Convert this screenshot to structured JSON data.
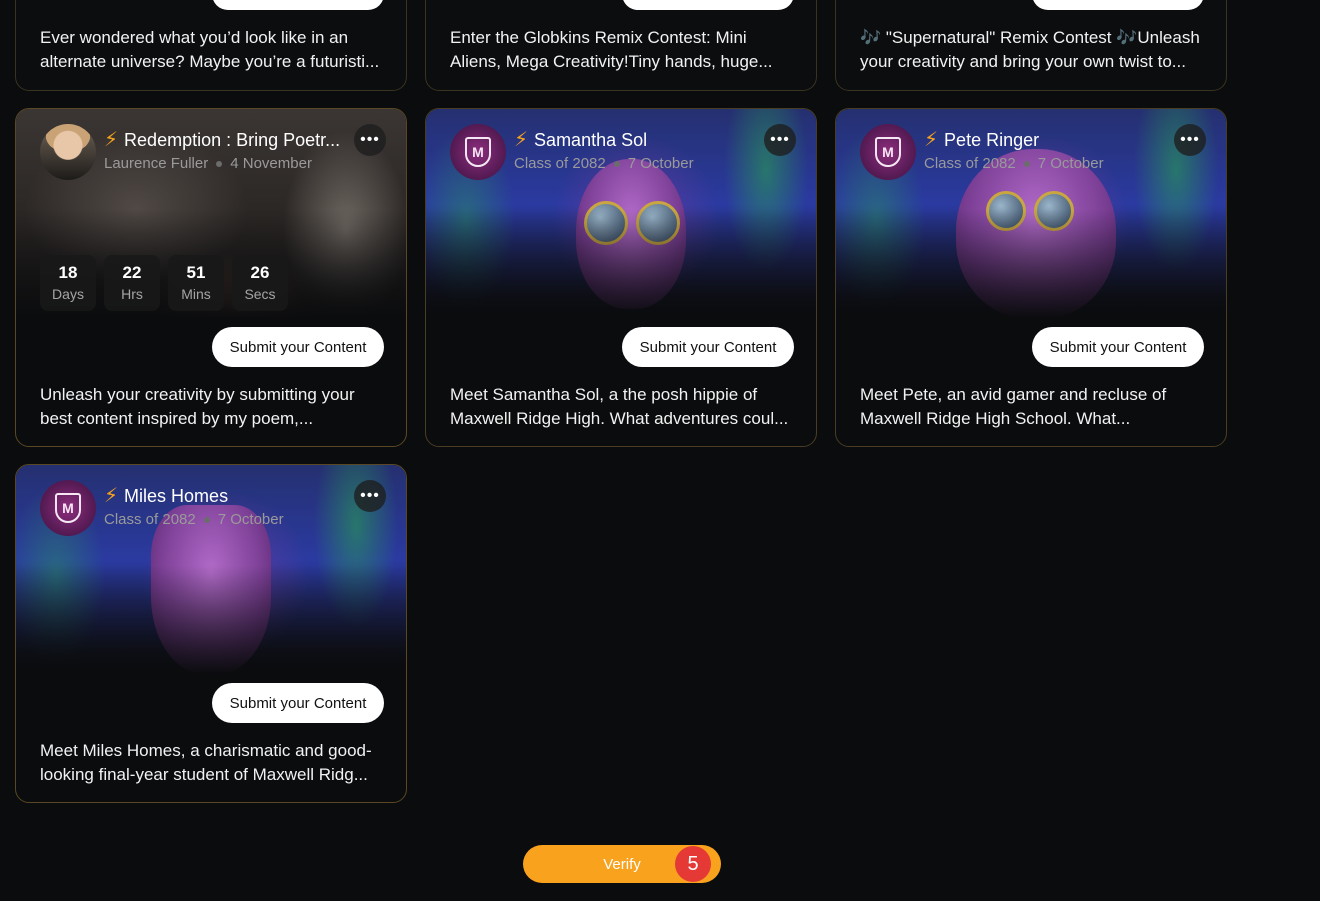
{
  "top_cards": [
    {
      "description": "Ever wondered what you’d look like in an alternate universe? Maybe you’re a futuristi..."
    },
    {
      "description": "Enter the Globkins Remix Contest: Mini Aliens, Mega Creativity!Tiny hands, huge..."
    },
    {
      "description": "🎶 \"Supernatural\" Remix Contest 🎶Unleash your creativity and bring your own twist to..."
    }
  ],
  "cards": [
    {
      "title": "Redemption : Bring Poetr...",
      "author": "Laurence Fuller",
      "date": "4 November",
      "countdown": [
        {
          "value": "18",
          "label": "Days"
        },
        {
          "value": "22",
          "label": "Hrs"
        },
        {
          "value": "51",
          "label": "Mins"
        },
        {
          "value": "26",
          "label": "Secs"
        }
      ],
      "button": "Submit your Content",
      "description": "Unleash your creativity by submitting your best content inspired by my poem,..."
    },
    {
      "title": "Samantha Sol",
      "author": "Class of 2082",
      "date": "7 October",
      "button": "Submit your Content",
      "description": "Meet Samantha Sol, a the posh hippie of Maxwell Ridge High. What adventures coul..."
    },
    {
      "title": "Pete Ringer",
      "author": "Class of 2082",
      "date": "7 October",
      "button": "Submit your Content",
      "description": "Meet Pete, an avid gamer and recluse of Maxwell Ridge High School. What..."
    },
    {
      "title": "Miles Homes",
      "author": "Class of 2082",
      "date": "7 October",
      "button": "Submit your Content",
      "description": "Meet Miles Homes, a charismatic and good-looking final-year student of Maxwell Ridg..."
    }
  ],
  "more_icon": "•••",
  "bolt_icon": "⚡",
  "crest_glyph": "M",
  "verify": {
    "label": "Verify",
    "badge": "5"
  },
  "colors": {
    "accent": "#f9a21e",
    "badge": "#e53935",
    "background": "#0a0c0d"
  }
}
